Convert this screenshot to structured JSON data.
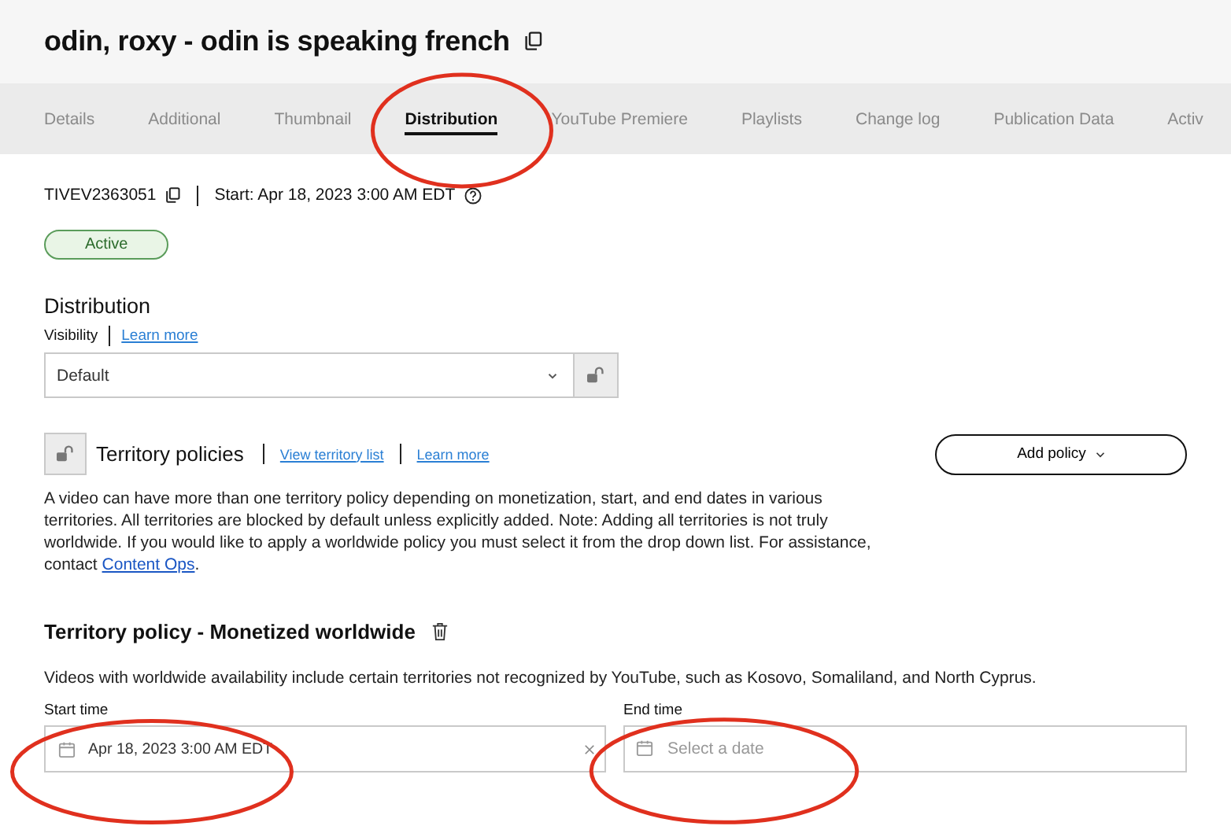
{
  "header": {
    "title": "odin, roxy - odin is speaking french"
  },
  "tabs": [
    {
      "label": "Details",
      "selected": false
    },
    {
      "label": "Additional",
      "selected": false
    },
    {
      "label": "Thumbnail",
      "selected": false
    },
    {
      "label": "Distribution",
      "selected": true
    },
    {
      "label": "YouTube Premiere",
      "selected": false
    },
    {
      "label": "Playlists",
      "selected": false
    },
    {
      "label": "Change log",
      "selected": false
    },
    {
      "label": "Publication Data",
      "selected": false
    },
    {
      "label": "Activ",
      "selected": false
    }
  ],
  "meta": {
    "id": "TIVEV2363051",
    "start": "Start: Apr 18, 2023 3:00 AM EDT",
    "status": "Active"
  },
  "distribution": {
    "heading": "Distribution",
    "visibility_label": "Visibility",
    "learn_more": "Learn more",
    "visibility_value": "Default"
  },
  "territory": {
    "heading": "Territory policies",
    "view_list": "View territory list",
    "learn_more": "Learn more",
    "add_button": "Add policy",
    "description": "A video can have more than one territory policy depending on monetization, start, and end dates in various territories. All territories are blocked by default unless explicitly added. Note: Adding all territories is not truly worldwide. If you would like to apply a worldwide policy you must select it from the drop down list. For assistance, contact ",
    "contact_link": "Content Ops",
    "description_end": "."
  },
  "policy": {
    "heading": "Territory policy - Monetized worldwide",
    "note": "Videos with worldwide availability include certain territories not recognized by YouTube, such as Kosovo, Somaliland, and North Cyprus.",
    "start_label": "Start time",
    "start_value": "Apr 18, 2023 3:00 AM EDT",
    "end_label": "End time",
    "end_placeholder": "Select a date"
  },
  "annotations": [
    {
      "kind": "ellipse"
    },
    {
      "kind": "ellipse"
    },
    {
      "kind": "ellipse"
    }
  ]
}
